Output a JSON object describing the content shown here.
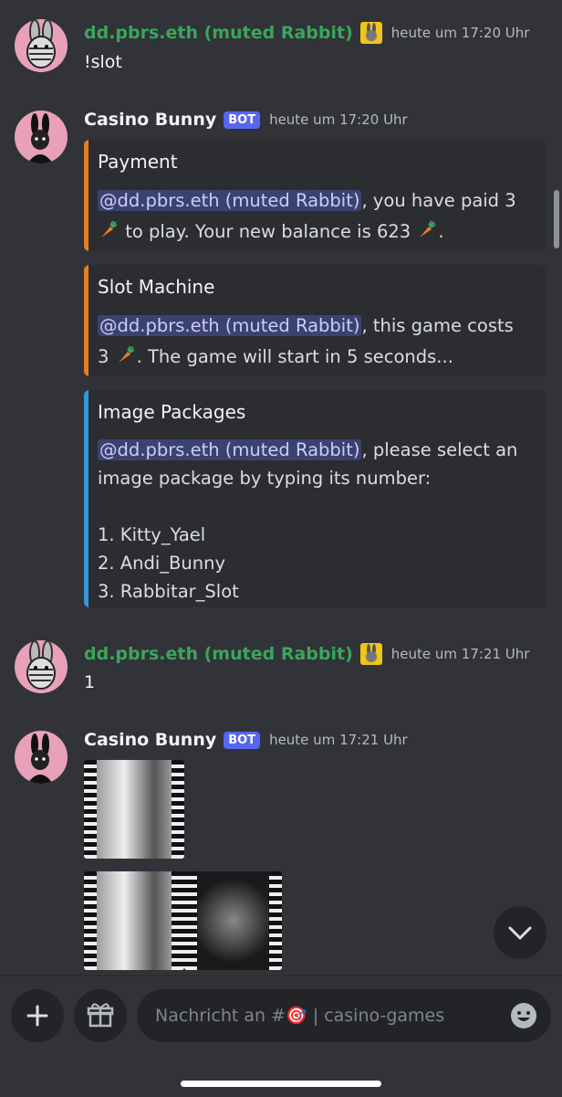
{
  "messages": [
    {
      "username": "dd.pbrs.eth (muted Rabbit)",
      "time": "heute um 17:20 Uhr",
      "text": "!slot"
    },
    {
      "username": "Casino Bunny",
      "badge": "BOT",
      "time": "heute um 17:20 Uhr"
    },
    {
      "username": "dd.pbrs.eth (muted Rabbit)",
      "time": "heute um 17:21 Uhr",
      "text": "1"
    },
    {
      "username": "Casino Bunny",
      "badge": "BOT",
      "time": "heute um 17:21 Uhr"
    }
  ],
  "embeds": {
    "payment": {
      "title": "Payment",
      "mention": "@dd.pbrs.eth (muted Rabbit)",
      "text1": ", you have paid 3",
      "text2": " to play. Your new balance is 623 ",
      "text3": "."
    },
    "slot": {
      "title": "Slot Machine",
      "mention": "@dd.pbrs.eth (muted Rabbit)",
      "text1": ", this game costs",
      "text2": "3 ",
      "text3": ". The game will start in 5 seconds..."
    },
    "packages": {
      "title": "Image Packages",
      "mention": "@dd.pbrs.eth (muted Rabbit)",
      "text1": ", please select an",
      "text2": "image package by typing its number:",
      "options": [
        "1. Kitty_Yael",
        "2. Andi_Bunny",
        "3. Rabbitar_Slot"
      ]
    }
  },
  "input": {
    "placeholder": "Nachricht an #🎯 | casino-games"
  },
  "colors": {
    "green_name": "#3ba55c",
    "bot_badge": "#5865f2",
    "orange_bar": "#e67e22",
    "blue_bar": "#3498db",
    "background": "#313338"
  },
  "icons": [
    "rabbit-avatar-icon",
    "bunny-avatar-icon",
    "carrot-icon",
    "chevron-down-icon",
    "plus-icon",
    "gift-icon",
    "smiley-icon",
    "rabbit-emoji-icon"
  ]
}
